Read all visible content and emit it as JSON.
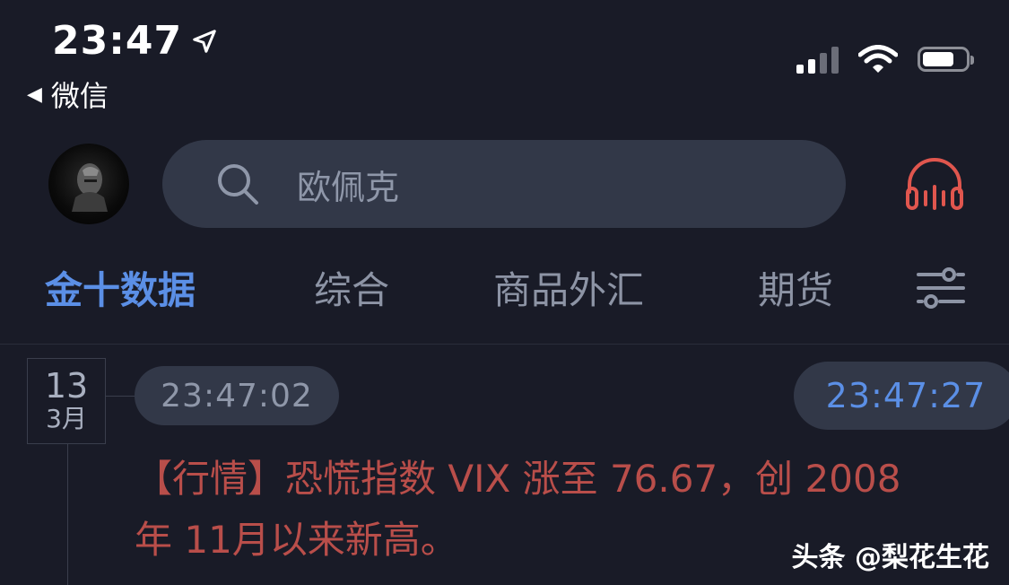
{
  "status_bar": {
    "time": "23:47",
    "back_app": "微信"
  },
  "search": {
    "placeholder": "欧佩克"
  },
  "tabs": [
    {
      "label": "金十数据",
      "active": true
    },
    {
      "label": "综合",
      "active": false
    },
    {
      "label": "商品外汇",
      "active": false
    },
    {
      "label": "期货",
      "active": false
    }
  ],
  "feed": {
    "date_day": "13",
    "date_month": "3月",
    "item_time": "23:47:02",
    "latest_time": "23:47:27",
    "news_text": "【行情】恐慌指数 VIX 涨至 76.67，创 2008 年 11月以来新高。"
  },
  "watermark": "头条 @梨花生花",
  "colors": {
    "background": "#191b27",
    "accent": "#5b8fe6",
    "news_red": "#b94e4a",
    "pill": "#323848",
    "headset": "#e0564e"
  }
}
